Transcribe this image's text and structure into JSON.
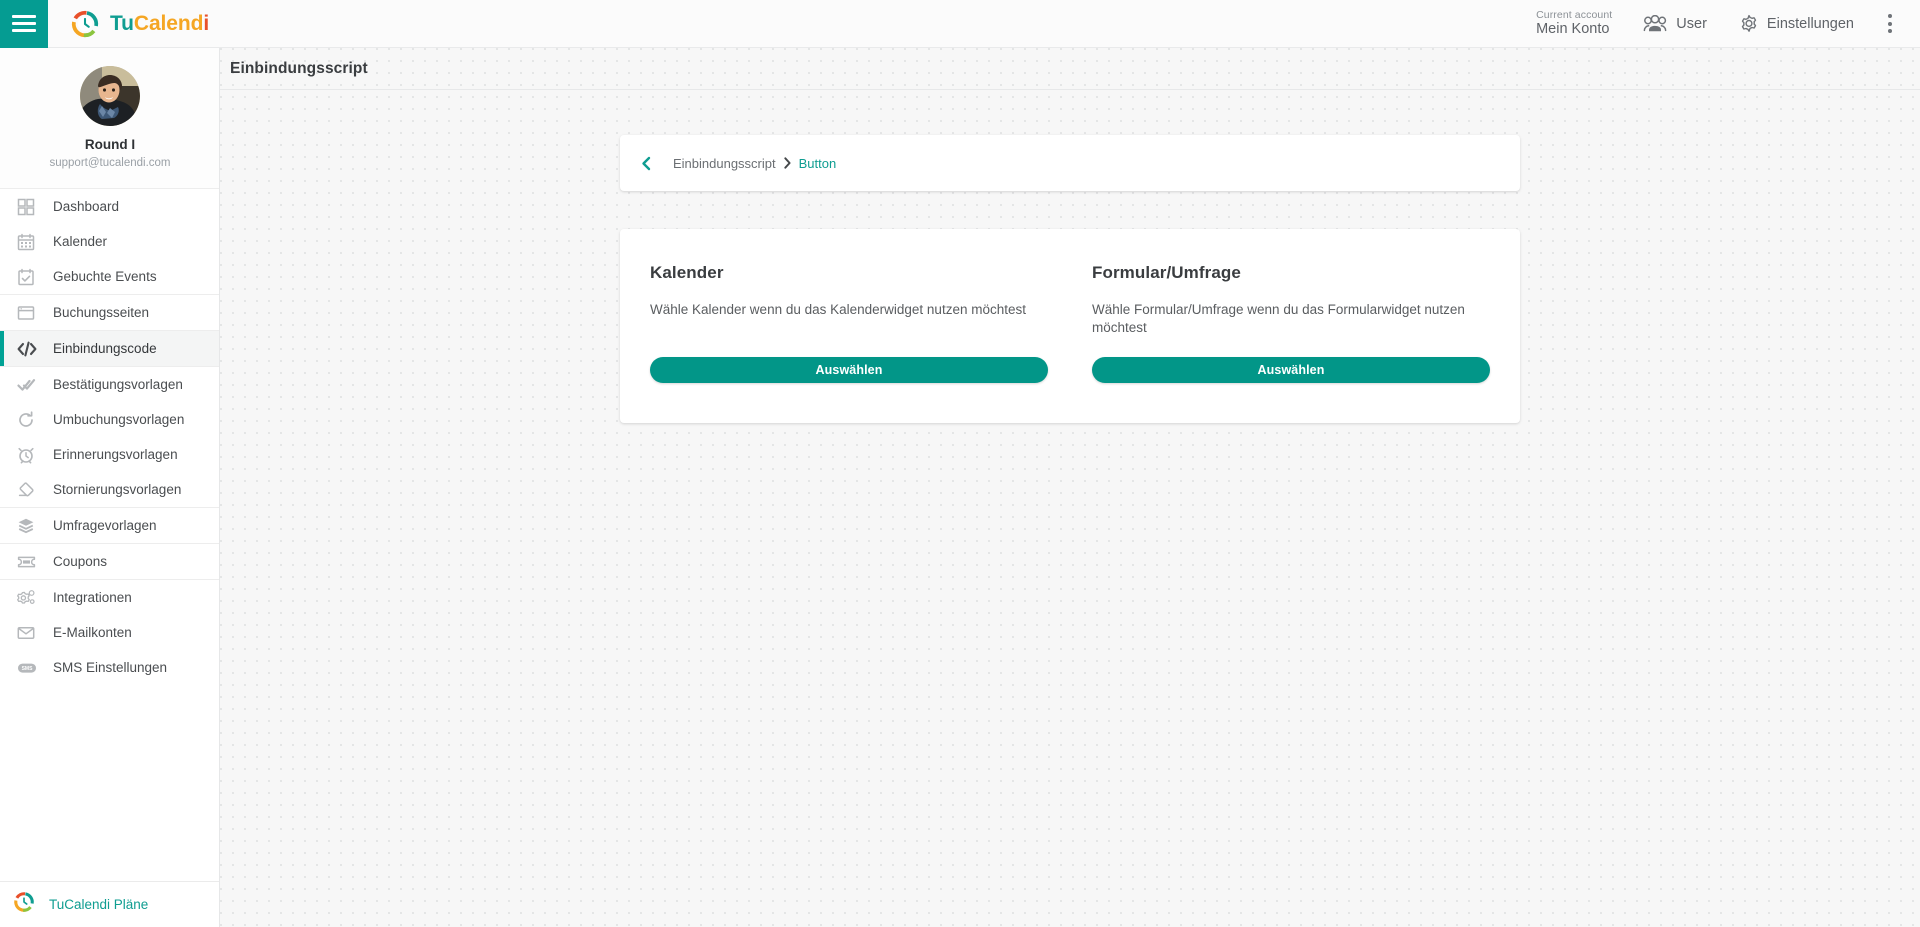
{
  "brand": {
    "name_part1": "Tu",
    "name_part2": "Calend",
    "name_part3": "i"
  },
  "topbar": {
    "account_label": "Current account",
    "account_name": "Mein Konto",
    "user_label": "User",
    "settings_label": "Einstellungen"
  },
  "colors": {
    "accent_teal": "#029688",
    "brand_teal": "#0f9d91",
    "brand_orange": "#f5a623",
    "brand_red": "#e8502a",
    "sidebar_active_bg": "#f4f5f5"
  },
  "profile": {
    "name": "Round I",
    "email": "support@tucalendi.com"
  },
  "sidebar": {
    "groups": [
      {
        "items": [
          {
            "label": "Dashboard",
            "icon": "grid-icon",
            "active": false
          },
          {
            "label": "Kalender",
            "icon": "calendar-icon",
            "active": false
          },
          {
            "label": "Gebuchte Events",
            "icon": "calendar-check-icon",
            "active": false
          }
        ]
      },
      {
        "items": [
          {
            "label": "Buchungsseiten",
            "icon": "window-icon",
            "active": false
          }
        ]
      },
      {
        "items": [
          {
            "label": "Einbindungscode",
            "icon": "code-icon",
            "active": true
          }
        ]
      },
      {
        "items": [
          {
            "label": "Bestätigungsvorlagen",
            "icon": "double-check-icon",
            "active": false
          },
          {
            "label": "Umbuchungsvorlagen",
            "icon": "refresh-icon",
            "active": false
          },
          {
            "label": "Erinnerungsvorlagen",
            "icon": "alarm-clock-icon",
            "active": false
          },
          {
            "label": "Stornierungsvorlagen",
            "icon": "eraser-icon",
            "active": false
          }
        ]
      },
      {
        "items": [
          {
            "label": "Umfragevorlagen",
            "icon": "layers-icon",
            "active": false
          }
        ]
      },
      {
        "items": [
          {
            "label": "Coupons",
            "icon": "ticket-icon",
            "active": false
          }
        ]
      },
      {
        "items": [
          {
            "label": "Integrationen",
            "icon": "gears-icon",
            "active": false
          },
          {
            "label": "E-Mailkonten",
            "icon": "envelope-icon",
            "active": false
          },
          {
            "label": "SMS Einstellungen",
            "icon": "sms-icon",
            "active": false
          }
        ]
      }
    ],
    "footer": {
      "label": "TuCalendi Pläne",
      "icon": "tucalendi-logo-icon"
    }
  },
  "page": {
    "title": "Einbindungsscript"
  },
  "breadcrumb": {
    "back_icon": "chevron-left-icon",
    "parent": "Einbindungsscript",
    "separator_icon": "chevron-right-icon",
    "current": "Button"
  },
  "cards": [
    {
      "title": "Kalender",
      "description": "Wähle Kalender wenn du das Kalenderwidget nutzen möchtest",
      "button_label": "Auswählen"
    },
    {
      "title": "Formular/Umfrage",
      "description": "Wähle Formular/Umfrage wenn du das Formularwidget nutzen möchtest",
      "button_label": "Auswählen"
    }
  ]
}
